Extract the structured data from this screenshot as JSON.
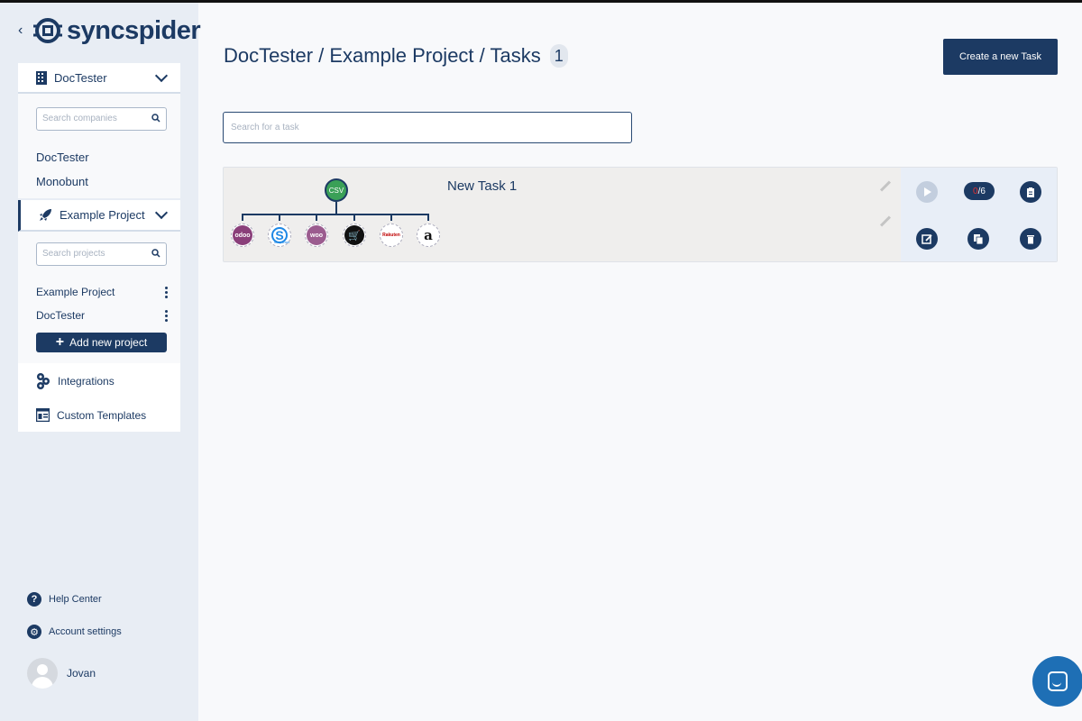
{
  "brand": {
    "name": "syncspider",
    "back_icon": "chevron-left-icon"
  },
  "sidebar": {
    "company_selector": {
      "label": "DocTester",
      "icon": "building-icon"
    },
    "company_search": {
      "placeholder": "Search companies"
    },
    "companies": [
      "DocTester",
      "Monobunt"
    ],
    "project_selector": {
      "label": "Example Project",
      "icon": "rocket-icon"
    },
    "project_search": {
      "placeholder": "Search projects"
    },
    "projects": [
      "Example Project",
      "DocTester"
    ],
    "add_project_label": "Add new project",
    "nav": [
      {
        "label": "Integrations",
        "icon": "gears-icon"
      },
      {
        "label": "Custom Templates",
        "icon": "template-icon"
      }
    ],
    "help_label": "Help Center",
    "account_label": "Account settings",
    "user_name": "Jovan"
  },
  "header": {
    "breadcrumb": "DocTester / Example Project / Tasks",
    "task_count": "1",
    "create_button": "Create a new Task"
  },
  "task_search": {
    "placeholder": "Search for a task"
  },
  "tasks": [
    {
      "name": "New Task 1",
      "source": "CSV",
      "targets": [
        "odoo",
        "shopware",
        "woo",
        "cart",
        "Rakuten",
        "a"
      ],
      "progress_done": "0",
      "progress_total": "6"
    }
  ],
  "colors": {
    "primary": "#1c3a63",
    "sidebar_bg": "#e8edf4",
    "csv_green": "#3aa057",
    "chat_blue": "#1e6fb5"
  }
}
